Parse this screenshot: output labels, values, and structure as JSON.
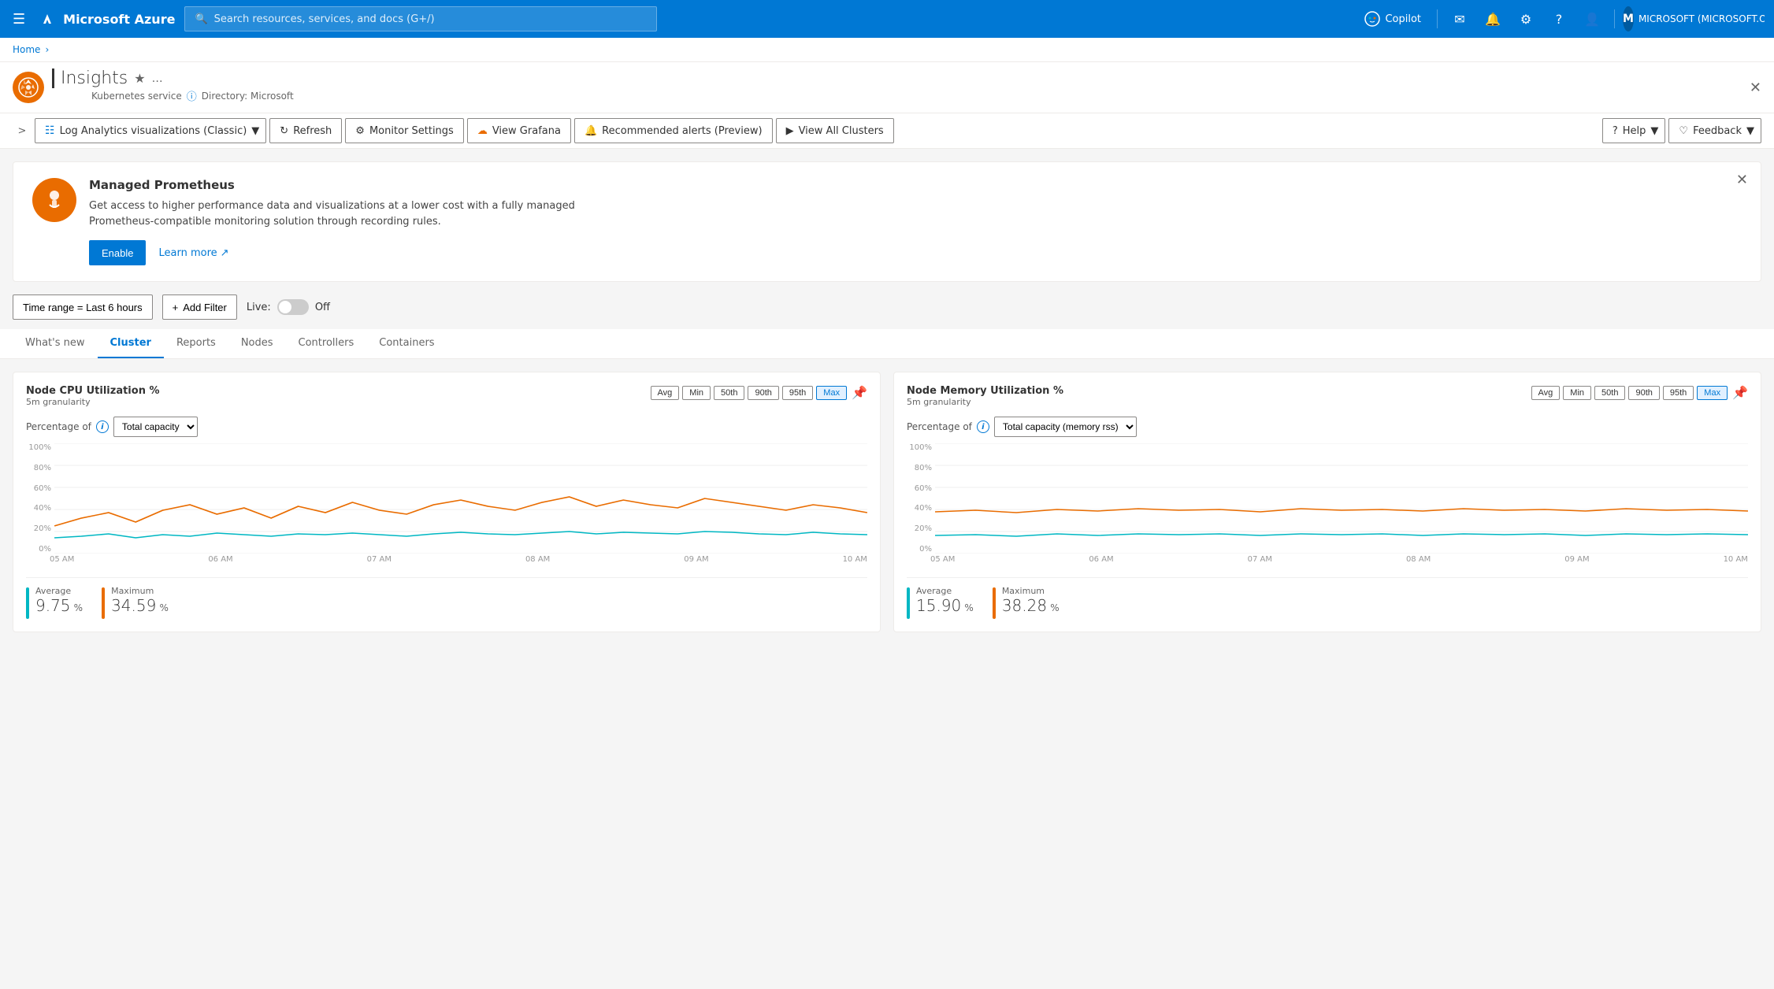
{
  "nav": {
    "hamburger_label": "☰",
    "logo": "Microsoft Azure",
    "search_placeholder": "Search resources, services, and docs (G+/)",
    "copilot_label": "Copilot",
    "icons": [
      "mail",
      "bell",
      "gear",
      "help",
      "person"
    ],
    "account_label": "MICROSOFT (MICROSOFT.ONMI...)"
  },
  "breadcrumb": {
    "home_label": "Home",
    "separator": "›"
  },
  "page": {
    "service_name": "Kubernetes service",
    "title": "Insights",
    "directory_label": "Directory: Microsoft",
    "close_label": "✕"
  },
  "toolbar": {
    "view_label": "Log Analytics visualizations (Classic)",
    "refresh_label": "Refresh",
    "monitor_settings_label": "Monitor Settings",
    "view_grafana_label": "View Grafana",
    "recommended_alerts_label": "Recommended alerts (Preview)",
    "view_all_clusters_label": "View All Clusters",
    "help_label": "Help",
    "feedback_label": "Feedback"
  },
  "banner": {
    "title": "Managed Prometheus",
    "description": "Get access to higher performance data and visualizations at a lower cost with a fully managed Prometheus-compatible monitoring solution through recording rules.",
    "enable_label": "Enable",
    "learn_more_label": "Learn more",
    "close_label": "✕"
  },
  "filters": {
    "time_range_label": "Time range = Last 6 hours",
    "add_filter_label": "Add Filter",
    "live_label": "Live:",
    "live_off_label": "Off"
  },
  "tabs": [
    {
      "id": "whats-new",
      "label": "What's new"
    },
    {
      "id": "cluster",
      "label": "Cluster",
      "active": true
    },
    {
      "id": "reports",
      "label": "Reports"
    },
    {
      "id": "nodes",
      "label": "Nodes"
    },
    {
      "id": "controllers",
      "label": "Controllers"
    },
    {
      "id": "containers",
      "label": "Containers"
    }
  ],
  "charts": {
    "cpu": {
      "title": "Node CPU Utilization %",
      "granularity": "5m granularity",
      "buttons": [
        "Avg",
        "Min",
        "50th",
        "90th",
        "95th",
        "Max"
      ],
      "active_button": "Max",
      "percentage_label": "Percentage of",
      "percentage_options": [
        "Total capacity"
      ],
      "percentage_selected": "Total capacity",
      "y_labels": [
        "100%",
        "80%",
        "60%",
        "40%",
        "20%",
        "0%"
      ],
      "x_labels": [
        "05 AM",
        "06 AM",
        "07 AM",
        "08 AM",
        "09 AM",
        "10 AM"
      ],
      "legend": [
        {
          "label": "Average",
          "value": "9.75",
          "unit": "%",
          "color": "#00b7c3"
        },
        {
          "label": "Maximum",
          "value": "34.59",
          "unit": "%",
          "color": "#e96c00"
        }
      ]
    },
    "memory": {
      "title": "Node Memory Utilization %",
      "granularity": "5m granularity",
      "buttons": [
        "Avg",
        "Min",
        "50th",
        "90th",
        "95th",
        "Max"
      ],
      "active_button": "Max",
      "percentage_label": "Percentage of",
      "percentage_options": [
        "Total capacity (memory rss)"
      ],
      "percentage_selected": "Total capacity (memory rss)",
      "y_labels": [
        "100%",
        "80%",
        "60%",
        "40%",
        "20%",
        "0%"
      ],
      "x_labels": [
        "05 AM",
        "06 AM",
        "07 AM",
        "08 AM",
        "09 AM",
        "10 AM"
      ],
      "legend": [
        {
          "label": "Average",
          "value": "15.90",
          "unit": "%",
          "color": "#00b7c3"
        },
        {
          "label": "Maximum",
          "value": "38.28",
          "unit": "%",
          "color": "#e96c00"
        }
      ]
    }
  }
}
